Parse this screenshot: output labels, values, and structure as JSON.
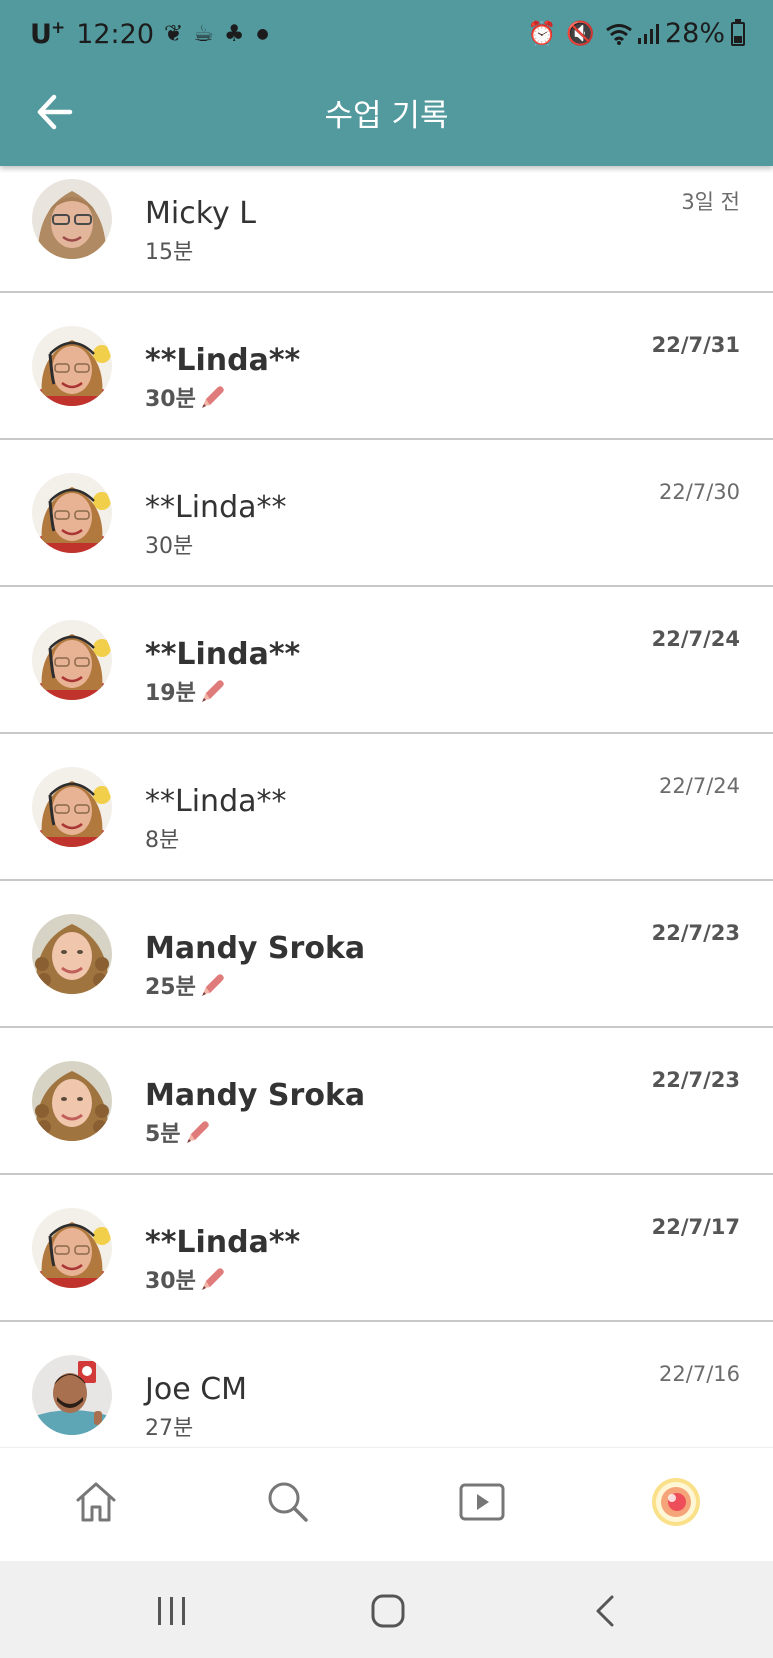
{
  "status_bar": {
    "carrier": "U",
    "carrier_sup": "+",
    "time": "12:20",
    "battery": "28%",
    "left_icons": [
      "leaf-icon",
      "cup-icon",
      "clover-icon",
      "dot-icon"
    ],
    "right_icons": [
      "alarm-icon",
      "mute-icon",
      "wifi-icon",
      "signal-icon",
      "battery-icon"
    ]
  },
  "header": {
    "title": "수업 기록",
    "back_icon": "arrow-left-icon",
    "background": "#539a9e"
  },
  "records": [
    {
      "name": "Micky L",
      "duration": "15분",
      "date": "3일 전",
      "bold": false,
      "edited": false,
      "avatar": "micky"
    },
    {
      "name": "**Linda**",
      "duration": "30분",
      "date": "22/7/31",
      "bold": true,
      "edited": true,
      "avatar": "linda"
    },
    {
      "name": "**Linda**",
      "duration": "30분",
      "date": "22/7/30",
      "bold": false,
      "edited": false,
      "avatar": "linda"
    },
    {
      "name": "**Linda**",
      "duration": "19분",
      "date": "22/7/24",
      "bold": true,
      "edited": true,
      "avatar": "linda"
    },
    {
      "name": "**Linda**",
      "duration": "8분",
      "date": "22/7/24",
      "bold": false,
      "edited": false,
      "avatar": "linda"
    },
    {
      "name": "Mandy Sroka",
      "duration": "25분",
      "date": "22/7/23",
      "bold": true,
      "edited": true,
      "avatar": "mandy"
    },
    {
      "name": "Mandy Sroka",
      "duration": "5분",
      "date": "22/7/23",
      "bold": true,
      "edited": true,
      "avatar": "mandy"
    },
    {
      "name": "**Linda**",
      "duration": "30분",
      "date": "22/7/17",
      "bold": true,
      "edited": true,
      "avatar": "linda"
    },
    {
      "name": "Joe CM",
      "duration": "27분",
      "date": "22/7/16",
      "bold": false,
      "edited": false,
      "avatar": "joe"
    }
  ],
  "bottom_nav": [
    "home-icon",
    "search-icon",
    "play-icon",
    "profile-icon"
  ],
  "system_nav": [
    "recents-icon",
    "home-circle-icon",
    "back-chevron-icon"
  ],
  "colors": {
    "accent": "#539a9e",
    "pencil": "#e07b7b",
    "divider": "#c8c8c8"
  }
}
